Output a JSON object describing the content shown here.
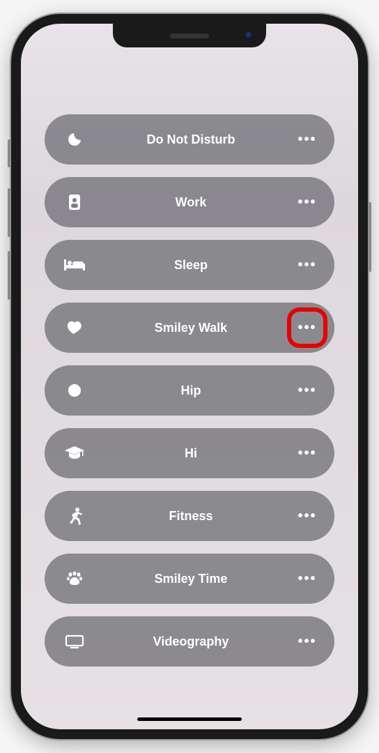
{
  "focus_modes": [
    {
      "icon": "moon-icon",
      "label": "Do Not Disturb",
      "highlight": false
    },
    {
      "icon": "badge-icon",
      "label": "Work",
      "highlight": false
    },
    {
      "icon": "bed-icon",
      "label": "Sleep",
      "highlight": false
    },
    {
      "icon": "heart-icon",
      "label": "Smiley Walk",
      "highlight": true
    },
    {
      "icon": "circle-icon",
      "label": "Hip",
      "highlight": false
    },
    {
      "icon": "graduation-icon",
      "label": "Hi",
      "highlight": false
    },
    {
      "icon": "running-icon",
      "label": "Fitness",
      "highlight": false
    },
    {
      "icon": "paw-icon",
      "label": "Smiley Time",
      "highlight": false
    },
    {
      "icon": "display-icon",
      "label": "Videography",
      "highlight": false
    }
  ],
  "more_glyph": "•••"
}
